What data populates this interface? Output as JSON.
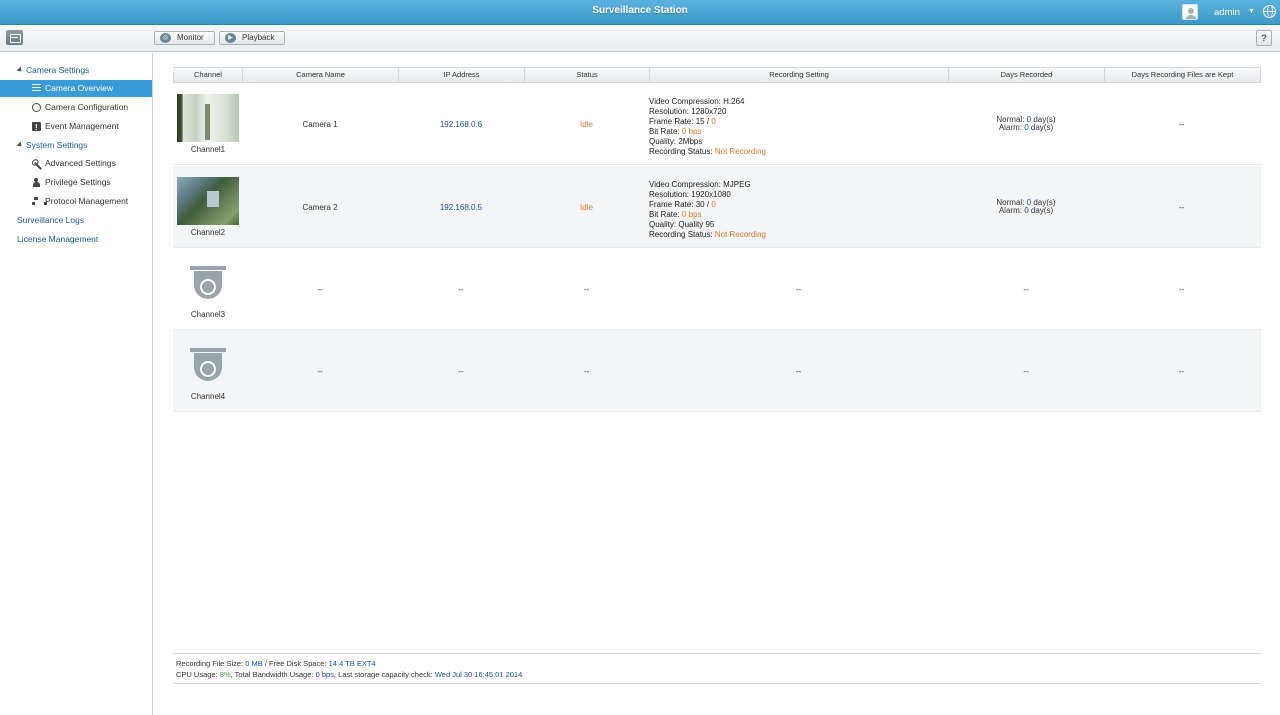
{
  "app": {
    "title": "Surveillance Station",
    "user": "admin",
    "accent_color": "#3a9bd9",
    "title_bar_color": "#4aa7d4"
  },
  "toolbar": {
    "monitor_label": "Monitor",
    "playback_label": "Playback",
    "help_label": "?"
  },
  "sidebar": {
    "camera_settings": "Camera Settings",
    "camera_overview": "Camera Overview",
    "camera_configuration": "Camera Configuration",
    "event_management": "Event Management",
    "system_settings": "System Settings",
    "advanced_settings": "Advanced Settings",
    "privilege_settings": "Privilege Settings",
    "protocol_management": "Protocol Management",
    "surveillance_logs": "Surveillance Logs",
    "license_management": "License Management"
  },
  "table": {
    "headers": [
      "Channel",
      "Camera Name",
      "IP Address",
      "Status",
      "Recording Setting",
      "Days Recorded",
      "Days Recording Files are Kept"
    ],
    "rows": [
      {
        "channel": "Channel1",
        "camera_name": "Camera 1",
        "ip": "192.168.0.6",
        "status": "Idle",
        "rec": {
          "compression_label": "Video Compression:",
          "compression": "H.264",
          "resolution_label": "Resolution:",
          "resolution": "1280x720",
          "framerate_label": "Frame Rate:",
          "framerate": "15",
          "framerate_sep": "/",
          "framerate_actual": "0",
          "bitrate_label": "Bit Rate:",
          "bitrate": "0 bps",
          "quality_label": "Quality:",
          "quality": "2Mbps",
          "status_label": "Recording Status:",
          "status": "Not Recording"
        },
        "days": {
          "normal_label": "Normal:",
          "normal": "0",
          "alarm_label": "Alarm:",
          "alarm": "0",
          "unit": "day(s)"
        },
        "kept": "--"
      },
      {
        "channel": "Channel2",
        "camera_name": "Camera 2",
        "ip": "192.168.0.5",
        "status": "Idle",
        "rec": {
          "compression_label": "Video Compression:",
          "compression": "MJPEG",
          "resolution_label": "Resolution:",
          "resolution": "1920x1080",
          "framerate_label": "Frame Rate:",
          "framerate": "30",
          "framerate_sep": "/",
          "framerate_actual": "0",
          "bitrate_label": "Bit Rate:",
          "bitrate": "0 bps",
          "quality_label": "Quality:",
          "quality": "Quality 95",
          "status_label": "Recording Status:",
          "status": "Not Recording"
        },
        "days": {
          "normal_label": "Normal:",
          "normal": "0",
          "alarm_label": "Alarm:",
          "alarm": "0",
          "unit": "day(s)"
        },
        "kept": "--"
      },
      {
        "channel": "Channel3",
        "camera_name": "--",
        "ip": "--",
        "status": "--",
        "rec_text": "--",
        "days_text": "--",
        "kept": "--"
      },
      {
        "channel": "Channel4",
        "camera_name": "--",
        "ip": "--",
        "status": "--",
        "rec_text": "--",
        "days_text": "--",
        "kept": "--"
      }
    ]
  },
  "footer": {
    "file_size_label": "Recording File Size:",
    "file_size": "0 MB",
    "sep": "/",
    "free_space_label": "Free Disk Space:",
    "free_space": "14.4 TB EXT4",
    "cpu_label": "CPU Usage:",
    "cpu": "8%",
    "bandwidth_label": ", Total Bandwidth Usage:",
    "bandwidth": "0 bps",
    "check_label": ", Last storage capacity check:",
    "check": "Wed Jul 30 16:45:01 2014"
  }
}
